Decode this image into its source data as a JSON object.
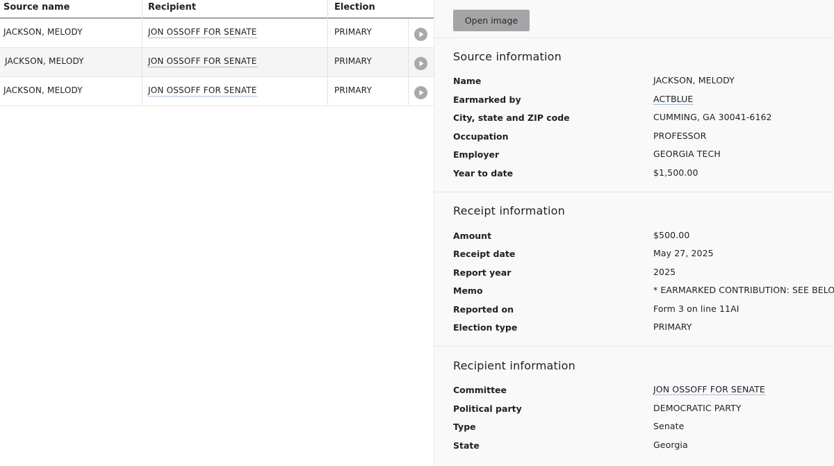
{
  "table": {
    "headers": {
      "source_name": "Source name",
      "recipient": "Recipient",
      "election": "Election"
    },
    "rows": [
      {
        "source_name": "JACKSON, MELODY",
        "recipient": "JON OSSOFF FOR SENATE",
        "election": "PRIMARY"
      },
      {
        "source_name": "JACKSON, MELODY",
        "recipient": "JON OSSOFF FOR SENATE",
        "election": "PRIMARY"
      },
      {
        "source_name": "JACKSON, MELODY",
        "recipient": "JON OSSOFF FOR SENATE",
        "election": "PRIMARY"
      }
    ]
  },
  "detail": {
    "open_image_label": "Open image",
    "source": {
      "title": "Source information",
      "rows": [
        {
          "label": "Name",
          "value": "JACKSON, MELODY"
        },
        {
          "label": "Earmarked by",
          "value": "ACTBLUE"
        },
        {
          "label": "City, state and ZIP code",
          "value": "CUMMING, GA 30041-6162"
        },
        {
          "label": "Occupation",
          "value": "PROFESSOR"
        },
        {
          "label": "Employer",
          "value": "GEORGIA TECH"
        },
        {
          "label": "Year to date",
          "value": "$1,500.00"
        }
      ]
    },
    "receipt": {
      "title": "Receipt information",
      "rows": [
        {
          "label": "Amount",
          "value": "$500.00"
        },
        {
          "label": "Receipt date",
          "value": "May 27, 2025"
        },
        {
          "label": "Report year",
          "value": "2025"
        },
        {
          "label": "Memo",
          "value": "* EARMARKED CONTRIBUTION: SEE BELOW"
        },
        {
          "label": "Reported on",
          "value": "Form 3 on line 11AI"
        },
        {
          "label": "Election type",
          "value": "PRIMARY"
        }
      ]
    },
    "recipient": {
      "title": "Recipient information",
      "rows": [
        {
          "label": "Committee",
          "value": "JON OSSOFF FOR SENATE"
        },
        {
          "label": "Political party",
          "value": "DEMOCRATIC PARTY"
        },
        {
          "label": "Type",
          "value": "Senate"
        },
        {
          "label": "State",
          "value": "Georgia"
        }
      ]
    }
  },
  "icons": {
    "row_action": "play-circle-icon"
  },
  "colors": {
    "link_underline": "#5b7fb0",
    "button_bg": "#a5a5a7",
    "panel_bg": "#f9f9f9",
    "row_alt_bg": "#f5f5f5"
  }
}
